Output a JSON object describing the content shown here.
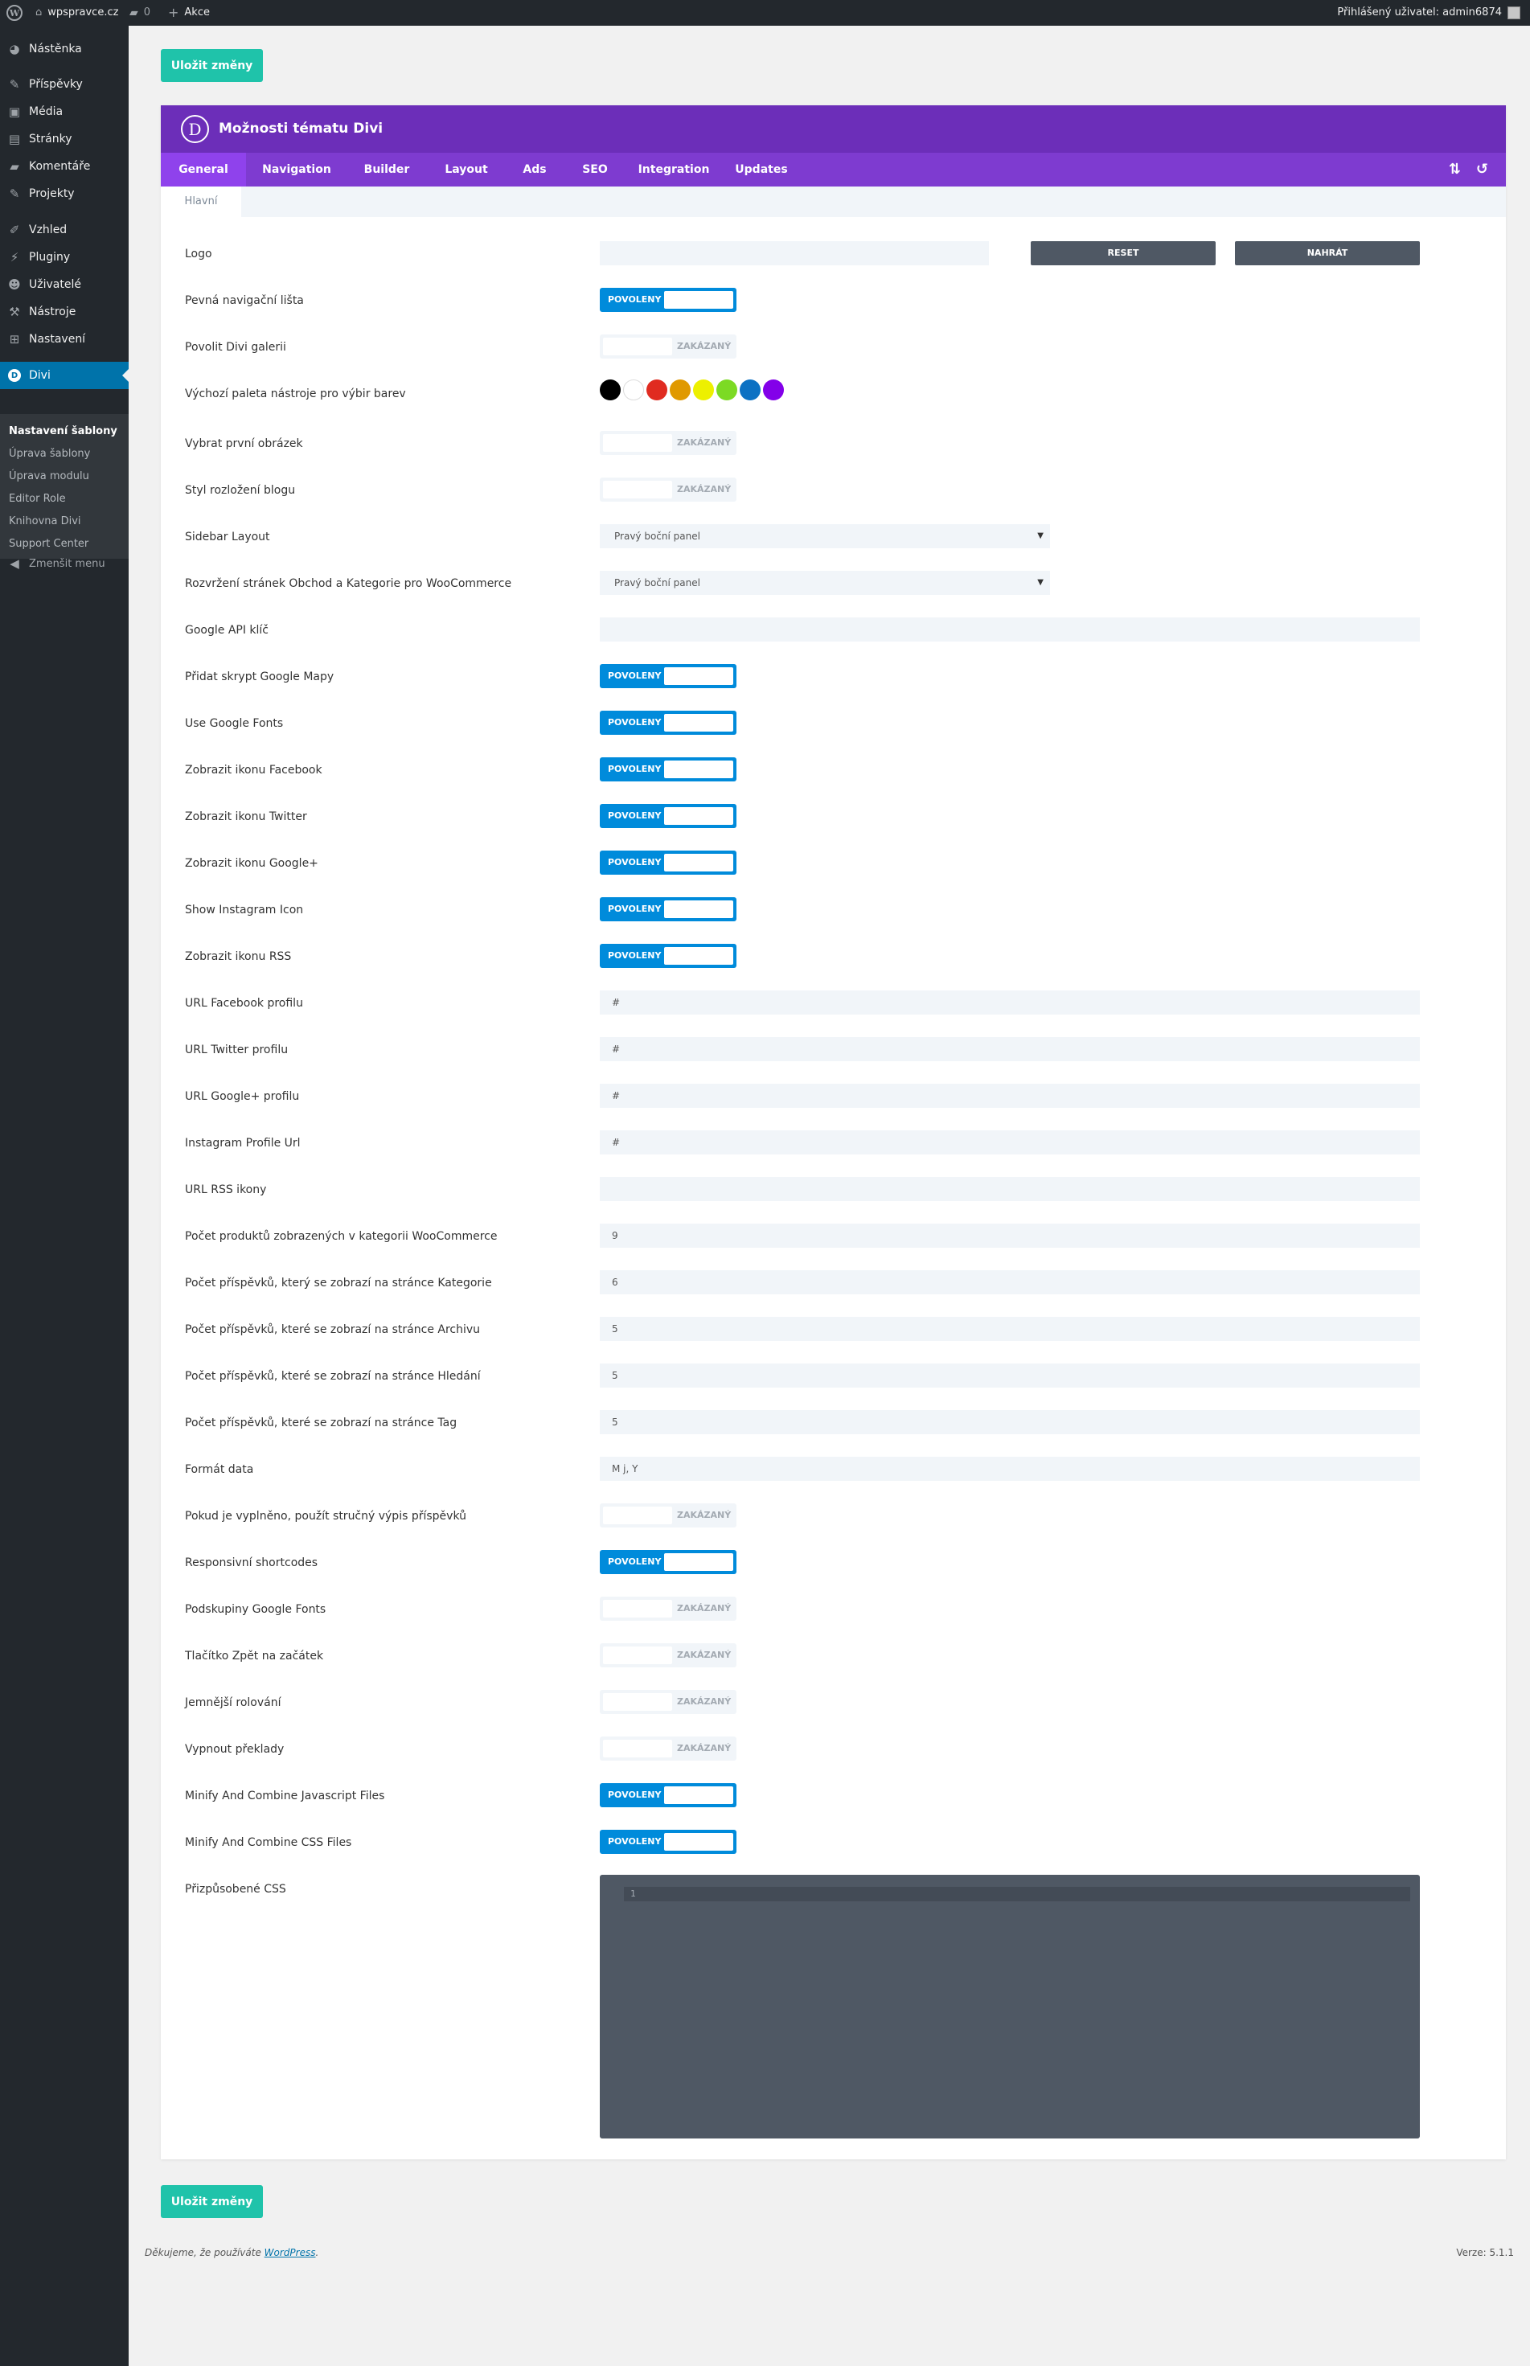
{
  "adminbar": {
    "site": "wpspravce.cz",
    "comments": "0",
    "new": "Akce",
    "user": "Přihlášený uživatel: admin6874"
  },
  "sidebar": {
    "items": [
      {
        "label": "Nástěnka",
        "icon": "dashboard-icon"
      },
      {
        "label": "Příspěvky",
        "icon": "pin-icon"
      },
      {
        "label": "Média",
        "icon": "media-icon"
      },
      {
        "label": "Stránky",
        "icon": "pages-icon"
      },
      {
        "label": "Komentáře",
        "icon": "comments-icon"
      },
      {
        "label": "Projekty",
        "icon": "pin-icon"
      },
      {
        "label": "Vzhled",
        "icon": "brush-icon"
      },
      {
        "label": "Pluginy",
        "icon": "plugin-icon"
      },
      {
        "label": "Uživatelé",
        "icon": "users-icon"
      },
      {
        "label": "Nástroje",
        "icon": "wrench-icon"
      },
      {
        "label": "Nastavení",
        "icon": "settings-icon"
      },
      {
        "label": "Divi",
        "icon": "divi-icon"
      }
    ],
    "submenu": [
      "Nastavení šablony",
      "Úprava šablony",
      "Úprava modulu",
      "Editor Role",
      "Knihovna Divi",
      "Support Center"
    ],
    "collapse": "Zmenšit menu"
  },
  "save_label": "Uložit změny",
  "panel": {
    "title": "Možnosti tématu Divi",
    "logo_letter": "D",
    "tabs": [
      "General",
      "Navigation",
      "Builder",
      "Layout",
      "Ads",
      "SEO",
      "Integration",
      "Updates"
    ],
    "subtab": "Hlavní"
  },
  "toggle_on": "POVOLENY",
  "toggle_off": "ZAKÁZANÝ",
  "buttons": {
    "reset": "RESET",
    "upload": "NAHRÁT"
  },
  "palette": [
    "#000000",
    "#ffffff",
    "#e02b20",
    "#e09900",
    "#edf000",
    "#7cda24",
    "#0c71c3",
    "#8300e9"
  ],
  "options": [
    {
      "label": "Logo",
      "type": "logo"
    },
    {
      "label": "Pevná navigační lišta",
      "type": "on"
    },
    {
      "label": "Povolit Divi galerii",
      "type": "off"
    },
    {
      "label": "Výchozí paleta nástroje pro výbir barev",
      "type": "palette"
    },
    {
      "label": "Vybrat první obrázek",
      "type": "off"
    },
    {
      "label": "Styl rozložení blogu",
      "type": "off"
    },
    {
      "label": "Sidebar Layout",
      "type": "select",
      "value": "Pravý boční panel"
    },
    {
      "label": "Rozvržení stránek Obchod a Kategorie pro WooCommerce",
      "type": "select",
      "value": "Pravý boční panel"
    },
    {
      "label": "Google API klíč",
      "type": "text",
      "value": ""
    },
    {
      "label": "Přidat skrypt Google Mapy",
      "type": "on"
    },
    {
      "label": "Use Google Fonts",
      "type": "on"
    },
    {
      "label": "Zobrazit ikonu Facebook",
      "type": "on"
    },
    {
      "label": "Zobrazit ikonu Twitter",
      "type": "on"
    },
    {
      "label": "Zobrazit ikonu Google+",
      "type": "on"
    },
    {
      "label": "Show Instagram Icon",
      "type": "on"
    },
    {
      "label": "Zobrazit ikonu RSS",
      "type": "on"
    },
    {
      "label": "URL Facebook profilu",
      "type": "text",
      "value": "#"
    },
    {
      "label": "URL Twitter profilu",
      "type": "text",
      "value": "#"
    },
    {
      "label": "URL Google+ profilu",
      "type": "text",
      "value": "#"
    },
    {
      "label": "Instagram Profile Url",
      "type": "text",
      "value": "#"
    },
    {
      "label": "URL RSS ikony",
      "type": "text",
      "value": ""
    },
    {
      "label": "Počet produktů zobrazených v kategorii WooCommerce",
      "type": "text",
      "value": "9"
    },
    {
      "label": "Počet příspěvků, který se zobrazí na stránce Kategorie",
      "type": "text",
      "value": "6"
    },
    {
      "label": "Počet příspěvků, které se zobrazí na stránce Archivu",
      "type": "text",
      "value": "5"
    },
    {
      "label": "Počet příspěvků, které se zobrazí na stránce Hledání",
      "type": "text",
      "value": "5"
    },
    {
      "label": "Počet příspěvků, které se zobrazí na stránce Tag",
      "type": "text",
      "value": "5"
    },
    {
      "label": "Formát data",
      "type": "text",
      "value": "M j, Y"
    },
    {
      "label": "Pokud je vyplněno, použít stručný výpis příspěvků",
      "type": "off"
    },
    {
      "label": "Responsivní shortcodes",
      "type": "on"
    },
    {
      "label": "Podskupiny Google Fonts",
      "type": "off"
    },
    {
      "label": "Tlačítko Zpět na začátek",
      "type": "off"
    },
    {
      "label": "Jemnější rolování",
      "type": "off"
    },
    {
      "label": "Vypnout překlady",
      "type": "off"
    },
    {
      "label": "Minify And Combine Javascript Files",
      "type": "on"
    },
    {
      "label": "Minify And Combine CSS Files",
      "type": "on"
    },
    {
      "label": "Přizpůsobené CSS",
      "type": "code",
      "line": "1"
    }
  ],
  "footer": {
    "thanks_prefix": "Děkujeme, že používáte ",
    "thanks_link": "WordPress",
    "thanks_suffix": ".",
    "version": "Verze: 5.1.1"
  }
}
